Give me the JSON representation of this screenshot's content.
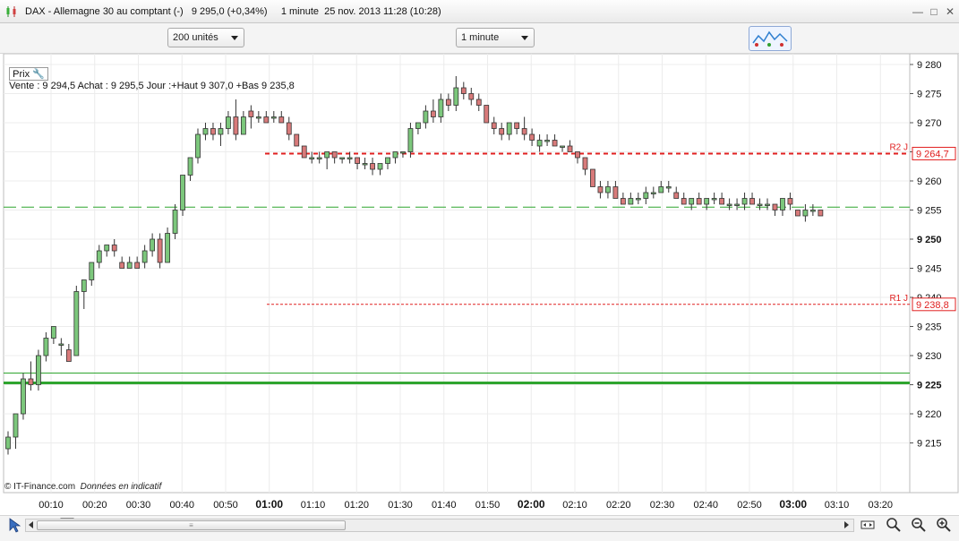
{
  "window": {
    "title": "DAX - Allemagne 30 au comptant (-)   9 295,0 (+0,34%)     1 minute  25 nov. 2013 11:28 (10:28)"
  },
  "toolbar": {
    "units_select": "200 unités",
    "interval_select": "1 minute"
  },
  "infobar": {
    "prix_label": "Prix",
    "quote": "Vente : 9 294,5 Achat : 9 295,5 Jour :+Haut 9 307,0 +Bas 9 235,8"
  },
  "footer": {
    "copyright": "© IT-Finance.com",
    "disclaimer": "Données en indicatif"
  },
  "colors": {
    "up_candle": "#7cc77c",
    "down_candle": "#d87a7a",
    "resistance": "#e02020",
    "support": "#2fa52f"
  },
  "chart_data": {
    "type": "candlestick",
    "y_ticks": [
      "9 280",
      "9 275",
      "9 270",
      "9 265",
      "9 260",
      "9 255",
      "9 250",
      "9 245",
      "9 240",
      "9 235",
      "9 230",
      "9 225",
      "9 220",
      "9 215"
    ],
    "y_range": [
      9212,
      9282
    ],
    "x_ticks": [
      "00:10",
      "00:20",
      "00:30",
      "00:40",
      "00:50",
      "01:00",
      "01:10",
      "01:20",
      "01:30",
      "01:40",
      "01:50",
      "02:00",
      "02:10",
      "02:20",
      "02:30",
      "02:40",
      "02:50",
      "03:00",
      "03:10",
      "03:20"
    ],
    "x_bold_ticks": [
      "01:00",
      "02:00",
      "03:00"
    ],
    "levels": [
      {
        "name": "R2 J",
        "value": 9264.7,
        "label": "9 264,7",
        "style": "bold-dashed"
      },
      {
        "name": "R1 J",
        "value": 9238.8,
        "label": "9 238,8",
        "style": "thin-dashed"
      }
    ],
    "support_lines": [
      9255.5,
      9227.0,
      9225.3
    ],
    "candles": [
      [
        9214,
        9217,
        9213,
        9216
      ],
      [
        9216,
        9220,
        9214,
        9220
      ],
      [
        9220,
        9227,
        9219,
        9226
      ],
      [
        9226,
        9229,
        9224,
        9225
      ],
      [
        9225,
        9231,
        9224,
        9230
      ],
      [
        9230,
        9234,
        9229,
        9233
      ],
      [
        9233,
        9235,
        9232,
        9235
      ],
      [
        9232,
        9233,
        9230,
        9232
      ],
      [
        9231,
        9232,
        9229,
        9229
      ],
      [
        9230,
        9242,
        9230,
        9241
      ],
      [
        9241,
        9243,
        9238,
        9243
      ],
      [
        9243,
        9246,
        9242,
        9246
      ],
      [
        9246,
        9249,
        9245,
        9248
      ],
      [
        9248,
        9249,
        9247,
        9249
      ],
      [
        9249,
        9250,
        9247,
        9248
      ],
      [
        9246,
        9247,
        9245,
        9245
      ],
      [
        9245,
        9247,
        9245,
        9246
      ],
      [
        9246,
        9247,
        9245,
        9245
      ],
      [
        9246,
        9249,
        9245,
        9248
      ],
      [
        9248,
        9251,
        9247,
        9250
      ],
      [
        9250,
        9251,
        9245,
        9246
      ],
      [
        9246,
        9252,
        9246,
        9251
      ],
      [
        9251,
        9256,
        9250,
        9255
      ],
      [
        9255,
        9261,
        9254,
        9261
      ],
      [
        9261,
        9264,
        9260,
        9264
      ],
      [
        9264,
        9269,
        9263,
        9268
      ],
      [
        9268,
        9270,
        9267,
        9269
      ],
      [
        9269,
        9270,
        9267,
        9268
      ],
      [
        9268,
        9270,
        9266,
        9269
      ],
      [
        9269,
        9272,
        9268,
        9271
      ],
      [
        9271,
        9274,
        9267,
        9268
      ],
      [
        9268,
        9272,
        9268,
        9271
      ],
      [
        9272,
        9273,
        9269,
        9271
      ],
      [
        9271,
        9272,
        9270,
        9271
      ],
      [
        9271,
        9272,
        9270,
        9270
      ],
      [
        9271,
        9272,
        9270,
        9271
      ],
      [
        9271,
        9272,
        9270,
        9270
      ],
      [
        9270,
        9271,
        9267,
        9268
      ],
      [
        9268,
        9268,
        9266,
        9266
      ],
      [
        9266,
        9266,
        9264,
        9264
      ],
      [
        9264,
        9265,
        9263,
        9264
      ],
      [
        9264,
        9265,
        9263,
        9264
      ],
      [
        9264,
        9265,
        9262,
        9265
      ],
      [
        9265,
        9265,
        9263,
        9264
      ],
      [
        9264,
        9264,
        9263,
        9264
      ],
      [
        9264,
        9265,
        9263,
        9264
      ],
      [
        9264,
        9264,
        9262,
        9263
      ],
      [
        9263,
        9264,
        9262,
        9263
      ],
      [
        9263,
        9264,
        9261,
        9262
      ],
      [
        9262,
        9263,
        9261,
        9263
      ],
      [
        9263,
        9264,
        9262,
        9264
      ],
      [
        9264,
        9265,
        9263,
        9265
      ],
      [
        9265,
        9265,
        9264,
        9265
      ],
      [
        9265,
        9270,
        9264,
        9269
      ],
      [
        9269,
        9270,
        9268,
        9270
      ],
      [
        9270,
        9273,
        9269,
        9272
      ],
      [
        9272,
        9274,
        9270,
        9271
      ],
      [
        9271,
        9275,
        9270,
        9274
      ],
      [
        9274,
        9275,
        9272,
        9273
      ],
      [
        9273,
        9278,
        9272,
        9276
      ],
      [
        9276,
        9277,
        9274,
        9275
      ],
      [
        9275,
        9276,
        9273,
        9274
      ],
      [
        9274,
        9275,
        9272,
        9273
      ],
      [
        9273,
        9273,
        9270,
        9270
      ],
      [
        9270,
        9271,
        9268,
        9269
      ],
      [
        9269,
        9270,
        9267,
        9268
      ],
      [
        9268,
        9270,
        9267,
        9270
      ],
      [
        9270,
        9270,
        9268,
        9269
      ],
      [
        9269,
        9271,
        9267,
        9268
      ],
      [
        9268,
        9269,
        9266,
        9267
      ],
      [
        9266,
        9268,
        9265,
        9267
      ],
      [
        9267,
        9268,
        9266,
        9267
      ],
      [
        9267,
        9268,
        9266,
        9266
      ],
      [
        9266,
        9266,
        9265,
        9266
      ],
      [
        9266,
        9267,
        9265,
        9265
      ],
      [
        9265,
        9265,
        9263,
        9264
      ],
      [
        9264,
        9264,
        9261,
        9262
      ],
      [
        9262,
        9262,
        9259,
        9259
      ],
      [
        9259,
        9260,
        9257,
        9258
      ],
      [
        9258,
        9260,
        9257,
        9259
      ],
      [
        9259,
        9260,
        9257,
        9257
      ],
      [
        9257,
        9258,
        9256,
        9256
      ],
      [
        9256,
        9258,
        9256,
        9257
      ],
      [
        9257,
        9258,
        9256,
        9257
      ],
      [
        9257,
        9259,
        9256,
        9258
      ],
      [
        9258,
        9259,
        9257,
        9258
      ],
      [
        9258,
        9260,
        9258,
        9259
      ],
      [
        9259,
        9260,
        9258,
        9259
      ],
      [
        9258,
        9259,
        9257,
        9257
      ],
      [
        9257,
        9258,
        9256,
        9256
      ],
      [
        9256,
        9257,
        9255,
        9257
      ],
      [
        9257,
        9258,
        9256,
        9256
      ],
      [
        9256,
        9257,
        9255,
        9257
      ],
      [
        9257,
        9258,
        9256,
        9257
      ],
      [
        9257,
        9258,
        9256,
        9256
      ],
      [
        9256,
        9257,
        9255,
        9256
      ],
      [
        9256,
        9257,
        9255,
        9256
      ],
      [
        9256,
        9258,
        9255,
        9257
      ],
      [
        9257,
        9258,
        9256,
        9256
      ],
      [
        9256,
        9257,
        9255,
        9256
      ],
      [
        9256,
        9257,
        9255,
        9256
      ],
      [
        9256,
        9256,
        9254,
        9255
      ],
      [
        9255,
        9257,
        9254,
        9257
      ],
      [
        9257,
        9258,
        9255,
        9256
      ],
      [
        9255,
        9255,
        9254,
        9254
      ],
      [
        9254,
        9256,
        9253,
        9255
      ],
      [
        9255,
        9256,
        9254,
        9255
      ],
      [
        9255,
        9255,
        9254,
        9254
      ]
    ]
  }
}
